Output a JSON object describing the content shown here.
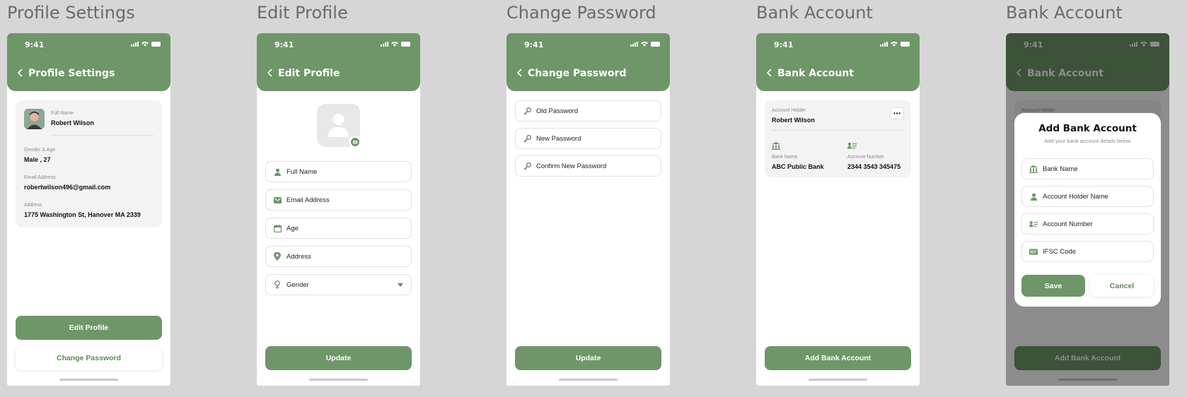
{
  "status": {
    "time": "9:41"
  },
  "screens": {
    "profile": {
      "label": "Profile Settings",
      "header": "Profile Settings",
      "full_name_label": "Full Name",
      "full_name": "Robert Wilson",
      "gender_age_label": "Gender & Age",
      "gender_age": "Male , 27",
      "email_label": "Email Address",
      "email": "robertwilson496@gmail.com",
      "address_label": "Address",
      "address": "1775 Washington St, Hanover MA 2339",
      "edit_button": "Edit Profile",
      "change_password_button": "Change Password"
    },
    "edit": {
      "label": "Edit Profile",
      "header": "Edit Profile",
      "fields": [
        "Full Name",
        "Email Address",
        "Age",
        "Address",
        "Gender"
      ],
      "update_button": "Update"
    },
    "password": {
      "label": "Change Password",
      "header": "Change Password",
      "fields": [
        "Old Password",
        "New Password",
        "Confirm New Password"
      ],
      "update_button": "Update"
    },
    "bank": {
      "label": "Bank Account",
      "header": "Bank Account",
      "holder_label": "Account Holder",
      "holder": "Robert Wilson",
      "bank_name_label": "Bank Name",
      "bank_name": "ABC Public Bank",
      "account_number_label": "Account Number",
      "account_number": "2344 3543 345475",
      "add_button": "Add Bank Account"
    },
    "bank_modal": {
      "label": "Bank Account",
      "header": "Bank Account",
      "holder_label": "Account Holder",
      "add_button": "Add Bank Account",
      "modal": {
        "title": "Add Bank Account",
        "subtitle": "Add your bank account details below",
        "fields": [
          "Bank Name",
          "Account Holder Name",
          "Account Number",
          "IFSC Code"
        ],
        "save": "Save",
        "cancel": "Cancel"
      }
    }
  },
  "colors": {
    "primary": "#6e9668",
    "background": "#d6d6d6",
    "card": "#f3f3f3"
  },
  "icons": {
    "edit_fields": [
      "user-icon",
      "mail-icon",
      "calendar-icon",
      "location-pin-icon",
      "gender-icon"
    ],
    "password_fields": [
      "key-icon",
      "key-icon",
      "key-icon"
    ],
    "modal_fields": [
      "bank-icon",
      "user-icon",
      "id-card-icon",
      "ifsc-icon"
    ]
  }
}
